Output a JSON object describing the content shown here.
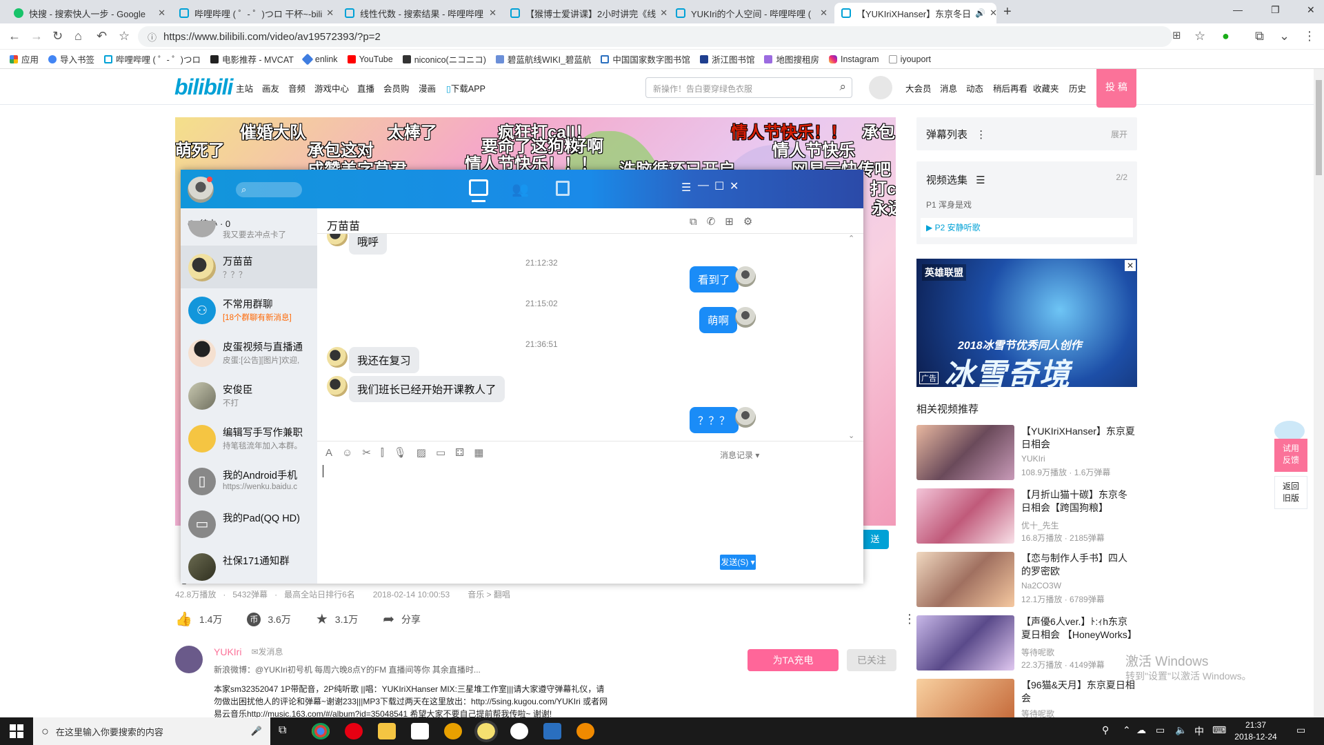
{
  "browser": {
    "tabs": [
      {
        "title": "快搜 - 搜索快人一步 - Google"
      },
      {
        "title": "哔哩哔哩 ( ゜- ゜)つロ 干杯~-bili"
      },
      {
        "title": "线性代数 - 搜索结果 - 哔哩哔哩"
      },
      {
        "title": "【猴博士爱讲课】2小时讲完《线"
      },
      {
        "title": "YUKIri的个人空间 - 哔哩哔哩 ("
      },
      {
        "title": "【YUKIriXHanser】东京冬日"
      }
    ],
    "url": "https://www.bilibili.com/video/av19572393/?p=2",
    "bookmarks": [
      "应用",
      "导入书签",
      "哔哩哔哩 ( ゜- ゜)つロ",
      "电影推荐 - MVCAT",
      "enlink",
      "YouTube",
      "niconico(ニコニコ)",
      "碧蓝航线WIKI_碧蓝航",
      "中国国家数字图书馆",
      "浙江图书馆",
      "地图搜租房",
      "Instagram",
      "iyouport"
    ]
  },
  "bili": {
    "logo": "bilibili",
    "nav": [
      "主站",
      "画友",
      "音频",
      "游戏中心",
      "直播",
      "会员购",
      "漫画",
      "下载APP"
    ],
    "search_placeholder": "新操作！告白要穿绿色衣服",
    "user_nav": [
      "大会员",
      "消息",
      "动态",
      "稍后再看",
      "收藏夹",
      "历史"
    ],
    "upload": "投 稿",
    "danmaku": [
      {
        "text": "催婚大队",
        "color": "white"
      },
      {
        "text": "太棒了",
        "color": "white"
      },
      {
        "text": "疯狂打call！",
        "color": "white"
      },
      {
        "text": "情人节快乐！！",
        "color": "red"
      },
      {
        "text": "承包",
        "color": "white"
      },
      {
        "text": "萌死了",
        "color": "white"
      },
      {
        "text": "承包这对",
        "color": "white"
      },
      {
        "text": "要命了这狗粮",
        "color": "white"
      },
      {
        "text": "好啊",
        "color": "white"
      },
      {
        "text": "情人节快乐",
        "color": "white"
      },
      {
        "text": "情人节快乐！！！",
        "color": "white"
      },
      {
        "text": "洗脑循环已开启",
        "color": "white"
      },
      {
        "text": "网易云快传吧",
        "color": "white"
      },
      {
        "text": "成赞美字草君",
        "color": "white"
      },
      {
        "text": "打c",
        "color": "white"
      },
      {
        "text": "永远",
        "color": "white"
      }
    ],
    "send": "送",
    "video_info": {
      "plays": "42.8万播放",
      "danmu": "5432弹幕",
      "rank": "最高全站日排行6名",
      "date": "2018-02-14 10:00:53",
      "category": "音乐 > 翻唱"
    },
    "actions": {
      "like": "1.4万",
      "coin": "3.6万",
      "fav": "3.1万",
      "share": "分享"
    },
    "uploader": {
      "name": "YUKIri",
      "msg": "发消息",
      "weibo": "新浪微博：@YUKIri初号机 每周六晚8点Y的FM 直播间等你 其余直播时...",
      "charge": "为TA充电",
      "followed": "已关注"
    },
    "desc": [
      "本家sm32352047 1P带配音，2P纯听歌 ||唱：YUKIriXHanser MIX:三星堆工作室|||请大家遵守弹幕礼仪，请",
      "勿做出困扰他人的评论和弹幕~谢谢233|||MP3下载过两天在这里放出：http://5sing.kugou.com/YUKIri 或者网",
      "易云音乐http://music.163.com/#/album?id=35048541 希望大家不要自己提前帮我传啦~ 谢谢!"
    ],
    "sidebar": {
      "danmaku_list": "弹幕列表",
      "expand": "展开",
      "collection": "视频选集",
      "collection_count": "2/2",
      "parts": [
        {
          "label": "P1  浑身是戏",
          "active": false
        },
        {
          "label": "P2  安静听歌",
          "active": true
        }
      ],
      "ad_title": "2018冰雪节优秀同人创作",
      "ad_big": "冰雪奇境",
      "ad_label": "广告",
      "ad_game": "英雄联盟",
      "related_title": "相关视频推荐",
      "related": [
        {
          "title": "【YUKIriXHanser】东京夏日相会",
          "up": "YUKIri",
          "stats": "108.9万播放 · 1.6万弹幕"
        },
        {
          "title": "【月折山猫十碳】东京冬日相会【跨国狗粮】",
          "up": "优十_先生",
          "stats": "16.8万播放 · 2185弹幕"
        },
        {
          "title": "【恋与制作人手书】四人的罗密欧",
          "up": "Na2CO3W",
          "stats": "12.1万播放 · 6789弹幕"
        },
        {
          "title": "【声優6人ver.】ﾄ:ｨh东京夏日相会 【HoneyWorks】",
          "up": "等待呢歌",
          "stats": "22.3万播放 · 4149弹幕"
        },
        {
          "title": "【96猫&天月】东京夏日相会",
          "up": "等待呢歌",
          "stats": ""
        }
      ],
      "feedback": "试用\n反馈",
      "old": "返回\n旧版"
    },
    "windows_watermark": {
      "line1": "激活 Windows",
      "line2": "转到\"设置\"以激活 Windows。"
    }
  },
  "qq": {
    "todo": "待办 · 0",
    "contacts": [
      {
        "name": "",
        "sub": "我又要去冲点卡了"
      },
      {
        "name": "万苗苗",
        "sub": "？？？"
      },
      {
        "name": "不常用群聊",
        "sub": "[18个群聊有新消息]"
      },
      {
        "name": "皮蛋视频与直播通",
        "sub": "皮蛋:[公告][图片]欢迎,"
      },
      {
        "name": "安俊臣",
        "sub": "不打"
      },
      {
        "name": "编辑写手写作兼职",
        "sub": "持笔毯流年加入本群。"
      },
      {
        "name": "我的Android手机",
        "sub": "https://wenku.baidu.c"
      },
      {
        "name": "我的Pad(QQ HD)",
        "sub": ""
      },
      {
        "name": "社保171通知群",
        "sub": ""
      }
    ],
    "chat_title": "万苗苗",
    "messages": [
      {
        "type": "left",
        "text": "哦呼"
      },
      {
        "type": "time",
        "text": "21:12:32"
      },
      {
        "type": "right",
        "text": "看到了"
      },
      {
        "type": "time",
        "text": "21:15:02"
      },
      {
        "type": "right",
        "text": "萌啊"
      },
      {
        "type": "time",
        "text": "21:36:51"
      },
      {
        "type": "left",
        "text": "我还在复习"
      },
      {
        "type": "left",
        "text": "我们班长已经开始开课教人了"
      },
      {
        "type": "right",
        "text": "？？？"
      }
    ],
    "history": "消息记录",
    "send_btn": "发送(S)"
  },
  "taskbar": {
    "search": "在这里输入你要搜索的内容",
    "time": "21:37",
    "date": "2018-12-24",
    "ime": "中"
  },
  "colors": {
    "bili_blue": "#00a1d6",
    "bili_pink": "#fb7299",
    "qq_blue": "#1296db"
  }
}
